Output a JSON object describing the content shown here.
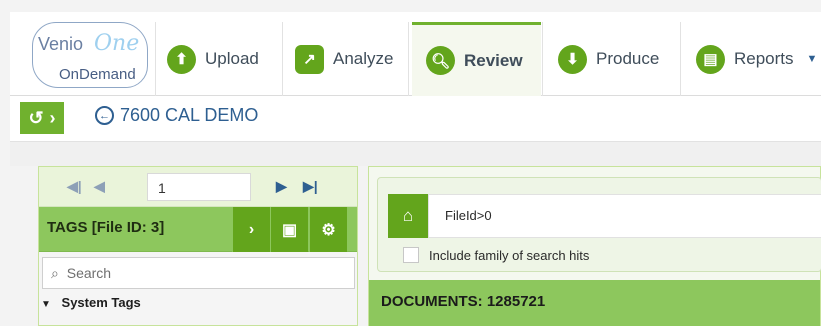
{
  "brand": {
    "name_part1": "Venio",
    "name_part2": "One",
    "tagline": "OnDemand"
  },
  "nav": {
    "tabs": [
      {
        "label": "Upload",
        "icon": "upload-icon"
      },
      {
        "label": "Analyze",
        "icon": "analyze-icon"
      },
      {
        "label": "Review",
        "icon": "search-icon",
        "active": true
      },
      {
        "label": "Produce",
        "icon": "produce-icon"
      },
      {
        "label": "Reports",
        "icon": "reports-icon"
      }
    ]
  },
  "case": {
    "title": "7600 CAL DEMO"
  },
  "pager": {
    "page_value": "1"
  },
  "tags": {
    "title": "TAGS [File ID: 3]",
    "search_placeholder": "Search",
    "system_tags_label": "System Tags"
  },
  "query": {
    "text": "FileId>0",
    "family_label": "Include family of search hits"
  },
  "documents": {
    "label": "DOCUMENTS: 1285721"
  },
  "colors": {
    "accent_green": "#63a51c",
    "light_green": "#8dc75d",
    "link_blue": "#2e5f91"
  }
}
